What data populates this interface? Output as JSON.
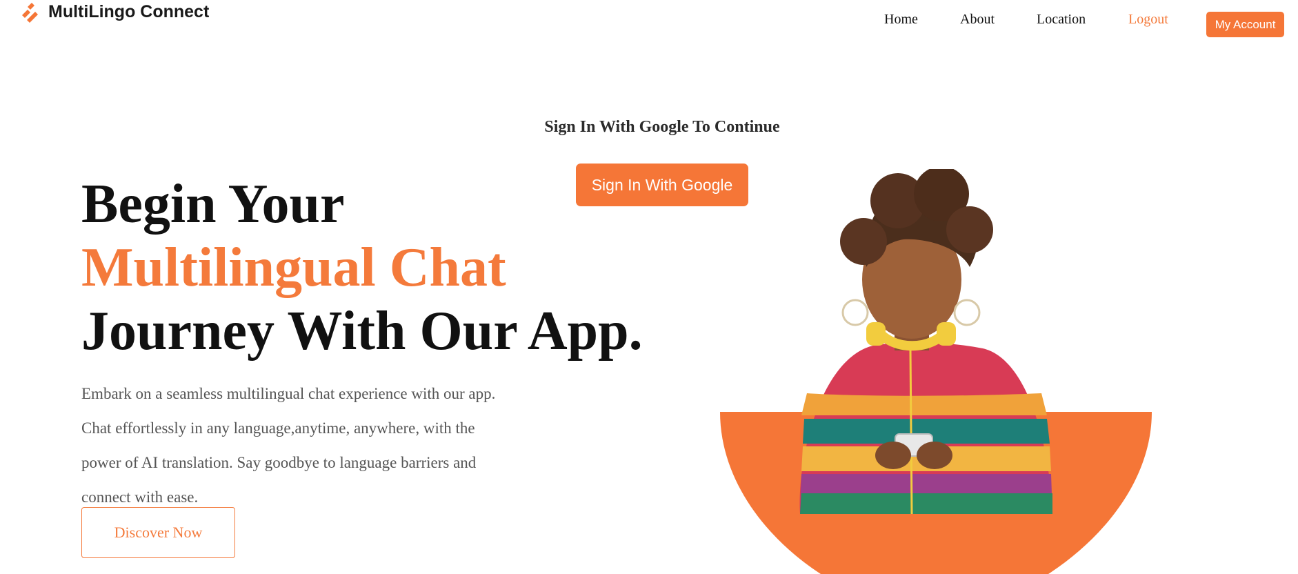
{
  "brand": {
    "name": "MultiLingo Connect",
    "accent_color": "#f57637",
    "icon": "diagonal-stripes-logo"
  },
  "nav": {
    "items": [
      {
        "label": "Home"
      },
      {
        "label": "About"
      },
      {
        "label": "Location"
      },
      {
        "label": "Logout"
      }
    ],
    "account_button": "My Account"
  },
  "signin": {
    "heading": "Sign In With Google To Continue",
    "button": "Sign In With Google"
  },
  "hero": {
    "title_line1": "Begin Your",
    "title_line2": "Multilingual Chat",
    "title_line3": "Journey With Our App.",
    "description": "Embark on a seamless multilingual chat experience with our app. Chat effortlessly in any language,anytime, anywhere, with the power of AI translation. Say goodbye to language barriers and connect with ease.",
    "cta": "Discover Now"
  },
  "illustration": {
    "icon": "woman-with-headphones-using-phone-illustration"
  }
}
